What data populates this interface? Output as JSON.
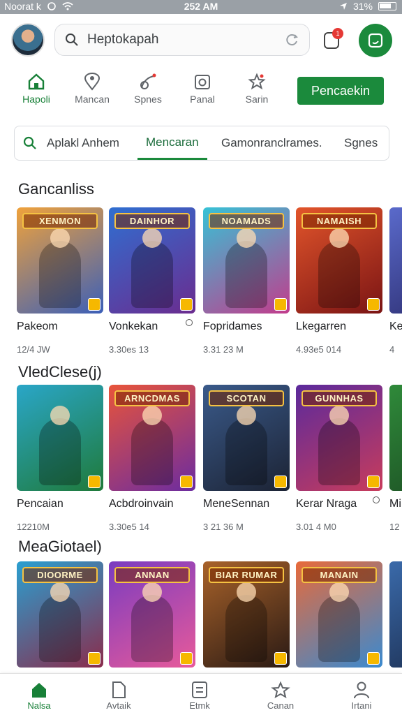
{
  "status_bar": {
    "carrier": "Noorat k",
    "time": "252 AM",
    "battery": "31%"
  },
  "search": {
    "query": "Heptokapah"
  },
  "notification": {
    "count": "1"
  },
  "categories": [
    {
      "label": "Hapoli",
      "icon": "home-icon",
      "active": true
    },
    {
      "label": "Mancan",
      "icon": "location-pin-icon",
      "active": false
    },
    {
      "label": "Spnes",
      "icon": "brush-icon",
      "active": false
    },
    {
      "label": "Panal",
      "icon": "camera-icon",
      "active": false
    },
    {
      "label": "Sarin",
      "icon": "star-icon",
      "active": false
    }
  ],
  "cta_label": "Pencaekin",
  "tabs": [
    {
      "label": "Aplakl Anhem",
      "active": false
    },
    {
      "label": "Mencaran",
      "active": true
    },
    {
      "label": "Gamonranclrames.",
      "active": false
    },
    {
      "label": "Sgnes",
      "active": false
    }
  ],
  "sections": [
    {
      "title": "Gancanliss",
      "items": [
        {
          "title_art": "XENMON",
          "name": "Pakeom",
          "meta": "12/4 JW",
          "colors": [
            "#f0a23b",
            "#3b5fb8"
          ],
          "pin": false
        },
        {
          "title_art": "DAINHOR",
          "name": "Vonkekan",
          "meta": "3.30es 13",
          "colors": [
            "#2f6fd1",
            "#6b2c8f"
          ],
          "pin": true
        },
        {
          "title_art": "NOAMADS",
          "name": "Fopridames",
          "meta": "3.31 23 M",
          "colors": [
            "#36c2d6",
            "#c23c8c"
          ],
          "pin": false
        },
        {
          "title_art": "NAMAISH",
          "name": "Lkegarren",
          "meta": "4.93e5 014",
          "colors": [
            "#e2552b",
            "#7a1414"
          ],
          "pin": false
        },
        {
          "title_art": "",
          "name": "Ke",
          "meta": "4",
          "colors": [
            "#5a6acb",
            "#2a2a6a"
          ],
          "pin": false
        }
      ]
    },
    {
      "title": "VledClese(j)",
      "items": [
        {
          "title_art": "",
          "name": "Pencaian",
          "meta": "12210M",
          "colors": [
            "#2aa6c8",
            "#1f7a3a"
          ],
          "pin": false
        },
        {
          "title_art": "ARNCDMAS",
          "name": "Acbdroinvain",
          "meta": "3.30e5 14",
          "colors": [
            "#e8543a",
            "#6c2ca0"
          ],
          "pin": false
        },
        {
          "title_art": "SCOTAN",
          "name": "MeneSennan",
          "meta": "3 21 36 M",
          "colors": [
            "#3a5a8a",
            "#1c2334"
          ],
          "pin": false
        },
        {
          "title_art": "GUNNHAS",
          "name": "Kerar Nraga",
          "meta": "3.01 4 M0",
          "colors": [
            "#5b2a9c",
            "#c83c5c"
          ],
          "pin": true
        },
        {
          "title_art": "",
          "name": "Mi",
          "meta": "12",
          "colors": [
            "#2f8a3a",
            "#1b4b22"
          ],
          "pin": false
        }
      ]
    },
    {
      "title": "MeaGiotael)",
      "items": [
        {
          "title_art": "DIOORME",
          "name": "",
          "meta": "",
          "colors": [
            "#2a9fd0",
            "#8a2c4c"
          ],
          "pin": false
        },
        {
          "title_art": "ANNAN",
          "name": "",
          "meta": "",
          "colors": [
            "#7a3cc0",
            "#e85a9a"
          ],
          "pin": false
        },
        {
          "title_art": "BIAR RUMAR",
          "name": "",
          "meta": "",
          "colors": [
            "#a8622a",
            "#2a1a14"
          ],
          "pin": false
        },
        {
          "title_art": "MANAIN",
          "name": "",
          "meta": "",
          "colors": [
            "#e86a3a",
            "#3a8ad0"
          ],
          "pin": false
        },
        {
          "title_art": "",
          "name": "",
          "meta": "",
          "colors": [
            "#3a6aaa",
            "#1a2a4a"
          ],
          "pin": false
        }
      ]
    }
  ],
  "bottom_nav": [
    {
      "label": "Nalsa",
      "icon": "home-icon",
      "active": true
    },
    {
      "label": "Avtaik",
      "icon": "document-icon",
      "active": false
    },
    {
      "label": "Etmk",
      "icon": "list-icon",
      "active": false
    },
    {
      "label": "Canan",
      "icon": "star-outline-icon",
      "active": false
    },
    {
      "label": "Irtani",
      "icon": "person-icon",
      "active": false
    }
  ],
  "accent_color": "#1b8a3c"
}
